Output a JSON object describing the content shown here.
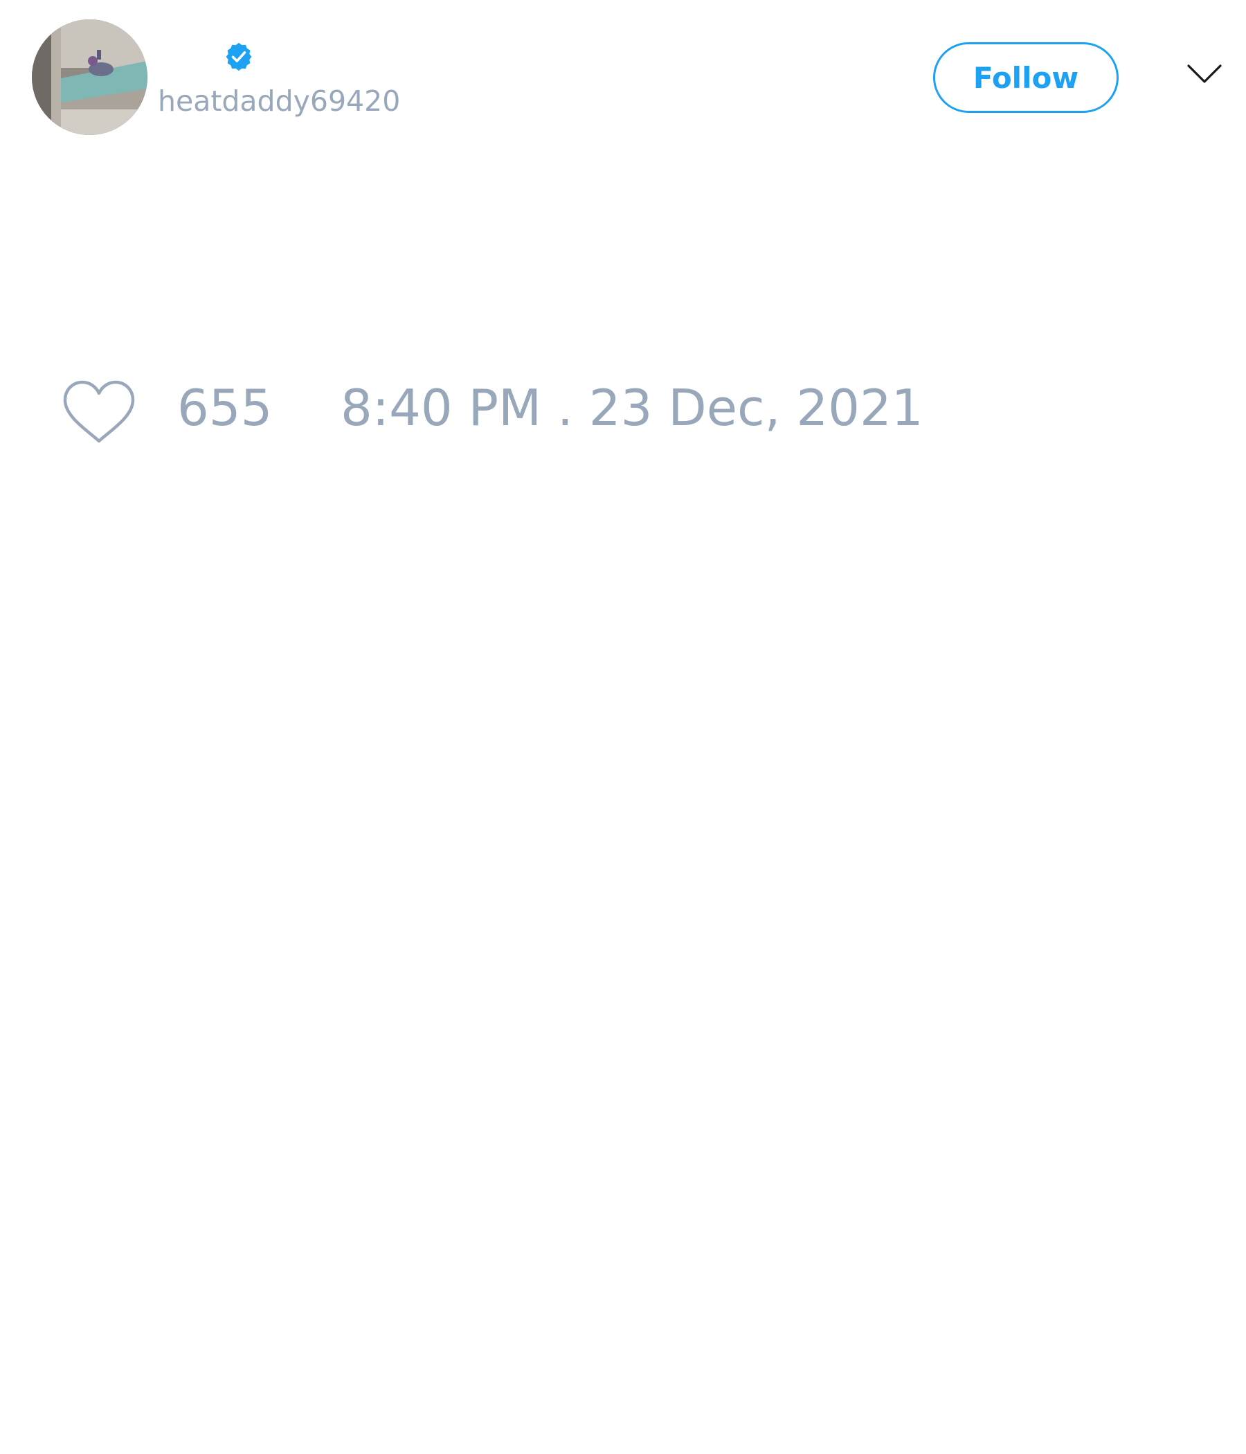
{
  "author": {
    "display_name": "",
    "handle": "heatdaddy69420",
    "verified": true,
    "verified_color": "#1da1f2",
    "avatar_icon": "profile-photo"
  },
  "header": {
    "follow_label": "Follow",
    "more_icon": "chevron-down-icon"
  },
  "footer": {
    "like_icon": "heart-icon",
    "like_count": "655",
    "timestamp": "8:40 PM . 23 Dec, 2021"
  },
  "colors": {
    "accent": "#1da1f2",
    "muted_text": "#98a7b9",
    "background": "#ffffff"
  }
}
